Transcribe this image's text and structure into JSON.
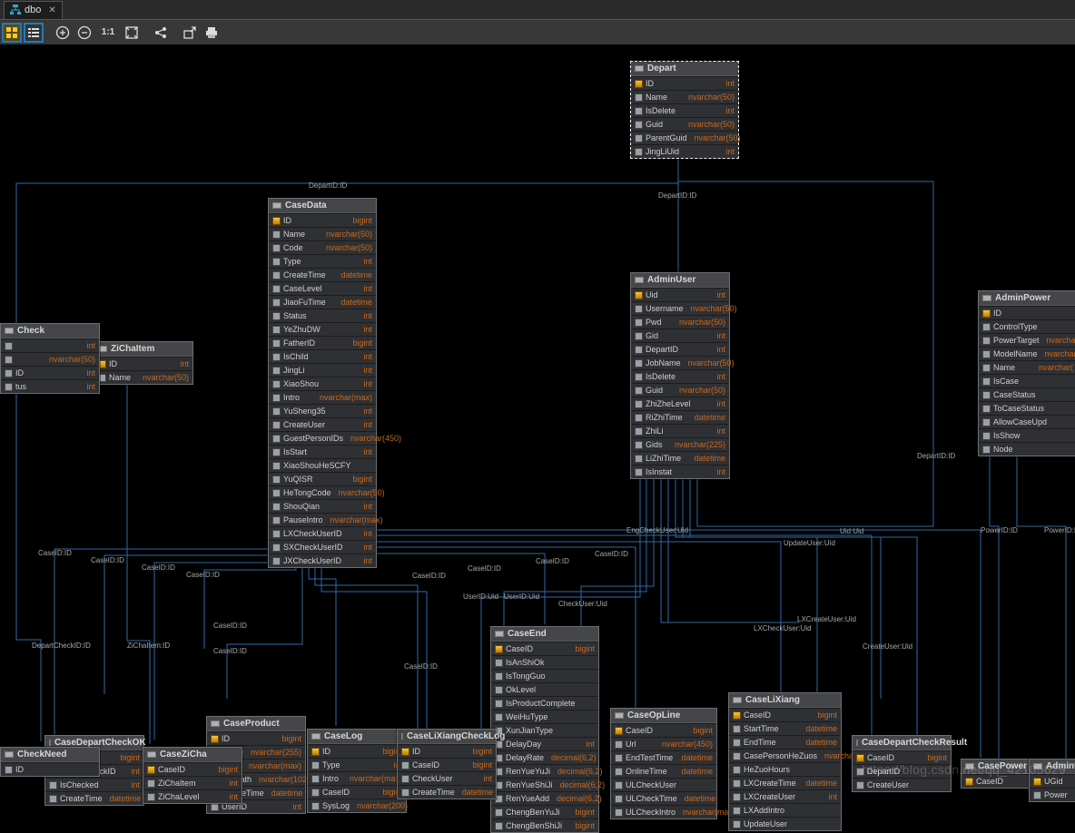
{
  "tab_title": "dbo",
  "toolbar": {
    "btn_grid": "⌗",
    "btn_list": "≣",
    "btn_plus": "⊕",
    "btn_minus": "⊖",
    "btn_11": "1:1",
    "btn_fit": "⛶",
    "btn_share": "⤴",
    "btn_export": "↗",
    "btn_print": "🖶"
  },
  "watermark": "https://blog.csdn.net/qq_42105629",
  "tables": {
    "Depart": {
      "title": "Depart",
      "cols": [
        {
          "n": "ID",
          "t": "int",
          "pk": true
        },
        {
          "n": "Name",
          "t": "nvarchar(50)"
        },
        {
          "n": "IsDelete",
          "t": "int"
        },
        {
          "n": "Guid",
          "t": "nvarchar(50)"
        },
        {
          "n": "ParentGuid",
          "t": "nvarchar(50)"
        },
        {
          "n": "JingLiUid",
          "t": "int"
        }
      ]
    },
    "AdminUser": {
      "title": "AdminUser",
      "cols": [
        {
          "n": "Uid",
          "t": "int",
          "pk": true
        },
        {
          "n": "Username",
          "t": "nvarchar(50)"
        },
        {
          "n": "Pwd",
          "t": "nvarchar(50)"
        },
        {
          "n": "Gid",
          "t": "int"
        },
        {
          "n": "DepartID",
          "t": "int"
        },
        {
          "n": "JobName",
          "t": "nvarchar(50)"
        },
        {
          "n": "IsDelete",
          "t": "int"
        },
        {
          "n": "Guid",
          "t": "nvarchar(50)"
        },
        {
          "n": "ZhiZheLevel",
          "t": "int"
        },
        {
          "n": "RiZhiTime",
          "t": "datetime"
        },
        {
          "n": "ZhiLi",
          "t": "int"
        },
        {
          "n": "Gids",
          "t": "nvarchar(225)"
        },
        {
          "n": "LiZhiTime",
          "t": "datetime"
        },
        {
          "n": "IsInstat",
          "t": "int"
        }
      ]
    },
    "AdminPower": {
      "title": "AdminPower",
      "cols": [
        {
          "n": "ID",
          "t": "",
          "pk": true
        },
        {
          "n": "ControlType",
          "t": ""
        },
        {
          "n": "PowerTarget",
          "t": "nvarchar("
        },
        {
          "n": "ModelName",
          "t": "nvarchar("
        },
        {
          "n": "Name",
          "t": "nvarchar("
        },
        {
          "n": "IsCase",
          "t": ""
        },
        {
          "n": "CaseStatus",
          "t": ""
        },
        {
          "n": "ToCaseStatus",
          "t": ""
        },
        {
          "n": "AllowCaseUpd",
          "t": ""
        },
        {
          "n": "IsShow",
          "t": ""
        },
        {
          "n": "Node",
          "t": ""
        }
      ]
    },
    "CaseData": {
      "title": "CaseData",
      "cols": [
        {
          "n": "ID",
          "t": "bigint",
          "pk": true
        },
        {
          "n": "Name",
          "t": "nvarchar(50)"
        },
        {
          "n": "Code",
          "t": "nvarchar(50)"
        },
        {
          "n": "Type",
          "t": "int"
        },
        {
          "n": "CreateTime",
          "t": "datetime"
        },
        {
          "n": "CaseLevel",
          "t": "int"
        },
        {
          "n": "JiaoFuTime",
          "t": "datetime"
        },
        {
          "n": "Status",
          "t": "int"
        },
        {
          "n": "YeZhuDW",
          "t": "int"
        },
        {
          "n": "FatherID",
          "t": "bigint"
        },
        {
          "n": "IsChild",
          "t": "int"
        },
        {
          "n": "JingLi",
          "t": "int"
        },
        {
          "n": "XiaoShou",
          "t": "int"
        },
        {
          "n": "Intro",
          "t": "nvarchar(max)"
        },
        {
          "n": "YuSheng35",
          "t": "int"
        },
        {
          "n": "CreateUser",
          "t": "int"
        },
        {
          "n": "GuestPersonIDs",
          "t": "nvarchar(450)"
        },
        {
          "n": "IsStart",
          "t": "int"
        },
        {
          "n": "XiaoShouHeSCFY",
          "t": ""
        },
        {
          "n": "YuQISR",
          "t": "bigint"
        },
        {
          "n": "HeTongCode",
          "t": "nvarchar(50)"
        },
        {
          "n": "ShouQian",
          "t": "int"
        },
        {
          "n": "PauseIntro",
          "t": "nvarchar(max)"
        },
        {
          "n": "LXCheckUserID",
          "t": "int"
        },
        {
          "n": "SXCheckUserID",
          "t": "int"
        },
        {
          "n": "JXCheckUserID",
          "t": "int"
        }
      ]
    },
    "ZiChaItem": {
      "title": "ZiChaItem",
      "cols": [
        {
          "n": "ID",
          "t": "int",
          "pk": true
        },
        {
          "n": "Name",
          "t": "nvarchar(50)"
        }
      ]
    },
    "CheckPartial": {
      "title": "Check",
      "cols": [
        {
          "n": "",
          "t": "int"
        },
        {
          "n": "",
          "t": "nvarchar(50)"
        },
        {
          "n": "ID",
          "t": "int"
        },
        {
          "n": "tus",
          "t": "int"
        }
      ]
    },
    "CaseEnd": {
      "title": "CaseEnd",
      "cols": [
        {
          "n": "CaseID",
          "t": "bigint",
          "pk": true
        },
        {
          "n": "IsAnShiOk",
          "t": ""
        },
        {
          "n": "IsTongGuo",
          "t": ""
        },
        {
          "n": "OkLevel",
          "t": ""
        },
        {
          "n": "IsProductComplete",
          "t": ""
        },
        {
          "n": "WeiHuType",
          "t": ""
        },
        {
          "n": "XunJianType",
          "t": ""
        },
        {
          "n": "DelayDay",
          "t": "int"
        },
        {
          "n": "DelayRate",
          "t": "decimal(6,2)"
        },
        {
          "n": "RenYueYuJi",
          "t": "decimal(6,2)"
        },
        {
          "n": "RenYueShiJi",
          "t": "decimal(6,2)"
        },
        {
          "n": "RenYueAdd",
          "t": "decimal(6,2)"
        },
        {
          "n": "ChengBenYuJi",
          "t": "bigint"
        },
        {
          "n": "ChengBenShiJi",
          "t": "bigint"
        }
      ]
    },
    "CaseOpLine": {
      "title": "CaseOpLine",
      "cols": [
        {
          "n": "CaseID",
          "t": "bigint",
          "pk": true
        },
        {
          "n": "Url",
          "t": "nvarchar(450)"
        },
        {
          "n": "EndTestTime",
          "t": "datetime"
        },
        {
          "n": "OnlineTime",
          "t": "datetime"
        },
        {
          "n": "ULCheckUser",
          "t": ""
        },
        {
          "n": "ULCheckTime",
          "t": "datetime"
        },
        {
          "n": "ULCheckIntro",
          "t": "nvarchar(max)"
        }
      ]
    },
    "CaseLiXiang": {
      "title": "CaseLiXiang",
      "cols": [
        {
          "n": "CaseID",
          "t": "bigint",
          "pk": true
        },
        {
          "n": "StartTime",
          "t": "datetime"
        },
        {
          "n": "EndTime",
          "t": "datetime"
        },
        {
          "n": "CasePersonHeZuos",
          "t": "nvarchar(450)"
        },
        {
          "n": "HeZuoHours",
          "t": ""
        },
        {
          "n": "LXCreateTime",
          "t": "datetime"
        },
        {
          "n": "LXCreateUser",
          "t": "int"
        },
        {
          "n": "LXAddIntro",
          "t": ""
        },
        {
          "n": "UpdateUser",
          "t": ""
        }
      ]
    },
    "CaseProduct": {
      "title": "CaseProduct",
      "cols": [
        {
          "n": "ID",
          "t": "bigint",
          "pk": true
        },
        {
          "n": "Name",
          "t": "nvarchar(255)"
        },
        {
          "n": "Intro",
          "t": "nvarchar(max)"
        },
        {
          "n": "FilePath",
          "t": "nvarchar(1023)"
        },
        {
          "n": "CreateTime",
          "t": "datetime"
        },
        {
          "n": "UserID",
          "t": "int"
        }
      ]
    },
    "CaseLog": {
      "title": "CaseLog",
      "cols": [
        {
          "n": "ID",
          "t": "bigint",
          "pk": true
        },
        {
          "n": "Type",
          "t": "int"
        },
        {
          "n": "Intro",
          "t": "nvarchar(max)"
        },
        {
          "n": "CaseID",
          "t": "bigint"
        },
        {
          "n": "SysLog",
          "t": "nvarchar(200)"
        }
      ]
    },
    "CaseLiXiangCheckLog": {
      "title": "CaseLiXiangCheckLog",
      "cols": [
        {
          "n": "ID",
          "t": "bigint",
          "pk": true
        },
        {
          "n": "CaseID",
          "t": "bigint"
        },
        {
          "n": "CheckUser",
          "t": "int"
        },
        {
          "n": "CreateTime",
          "t": "datetime"
        }
      ]
    },
    "CaseDepartCheckOK": {
      "title": "CaseDepartCheckOK",
      "cols": [
        {
          "n": "CaseID",
          "t": "bigint",
          "pk": true
        },
        {
          "n": "DepartCheckID",
          "t": "int"
        },
        {
          "n": "IsChecked",
          "t": "int"
        },
        {
          "n": "CreateTime",
          "t": "datetime"
        }
      ]
    },
    "CaseZiCha": {
      "title": "CaseZiCha",
      "cols": [
        {
          "n": "CaseID",
          "t": "bigint",
          "pk": true
        },
        {
          "n": "ZiChaItem",
          "t": "int"
        },
        {
          "n": "ZiChaLevel",
          "t": "int"
        }
      ]
    },
    "CheckNeed": {
      "title": "CheckNeed",
      "cols": [
        {
          "n": "ID",
          "t": ""
        }
      ]
    },
    "CaseDepartCheckResult": {
      "title": "CaseDepartCheckResult",
      "cols": [
        {
          "n": "CaseID",
          "t": "bigint",
          "pk": true
        },
        {
          "n": "DepartID",
          "t": ""
        },
        {
          "n": "CreateUser",
          "t": ""
        }
      ]
    },
    "CasePower": {
      "title": "CasePower",
      "cols": [
        {
          "n": "CaseID",
          "t": "bigint",
          "pk": true
        }
      ]
    },
    "AdminUiGh": {
      "title": "AdminUiGh",
      "cols": [
        {
          "n": "UGid",
          "t": "",
          "pk": true
        },
        {
          "n": "Power",
          "t": ""
        }
      ]
    }
  },
  "relations": [
    {
      "label": "DepartID:ID"
    },
    {
      "label": "DepartID:ID"
    },
    {
      "label": "CaseID:ID"
    },
    {
      "label": "CaseID:ID"
    },
    {
      "label": "CaseID:ID"
    },
    {
      "label": "CaseID:ID"
    },
    {
      "label": "CaseID:ID"
    },
    {
      "label": "CaseID:ID"
    },
    {
      "label": "CaseID:ID"
    },
    {
      "label": "CaseID:ID"
    },
    {
      "label": "CaseID:ID"
    },
    {
      "label": "CaseID:ID"
    },
    {
      "label": "ZiChaItem:ID"
    },
    {
      "label": "DepartCheckID:ID"
    },
    {
      "label": "UserID:Uid"
    },
    {
      "label": "UserID:Uid"
    },
    {
      "label": "CheckUser:Uid"
    },
    {
      "label": "LXCheckUser:Uid"
    },
    {
      "label": "LXCreateUser:Uid"
    },
    {
      "label": "UpdateUser:Uid"
    },
    {
      "label": "CreateUser:Uid"
    },
    {
      "label": "Uid:Uid"
    },
    {
      "label": "EngCheckUser:Uid"
    },
    {
      "label": "PowerID:ID"
    },
    {
      "label": "PowerID:ID"
    },
    {
      "label": "DepartID:ID"
    }
  ]
}
